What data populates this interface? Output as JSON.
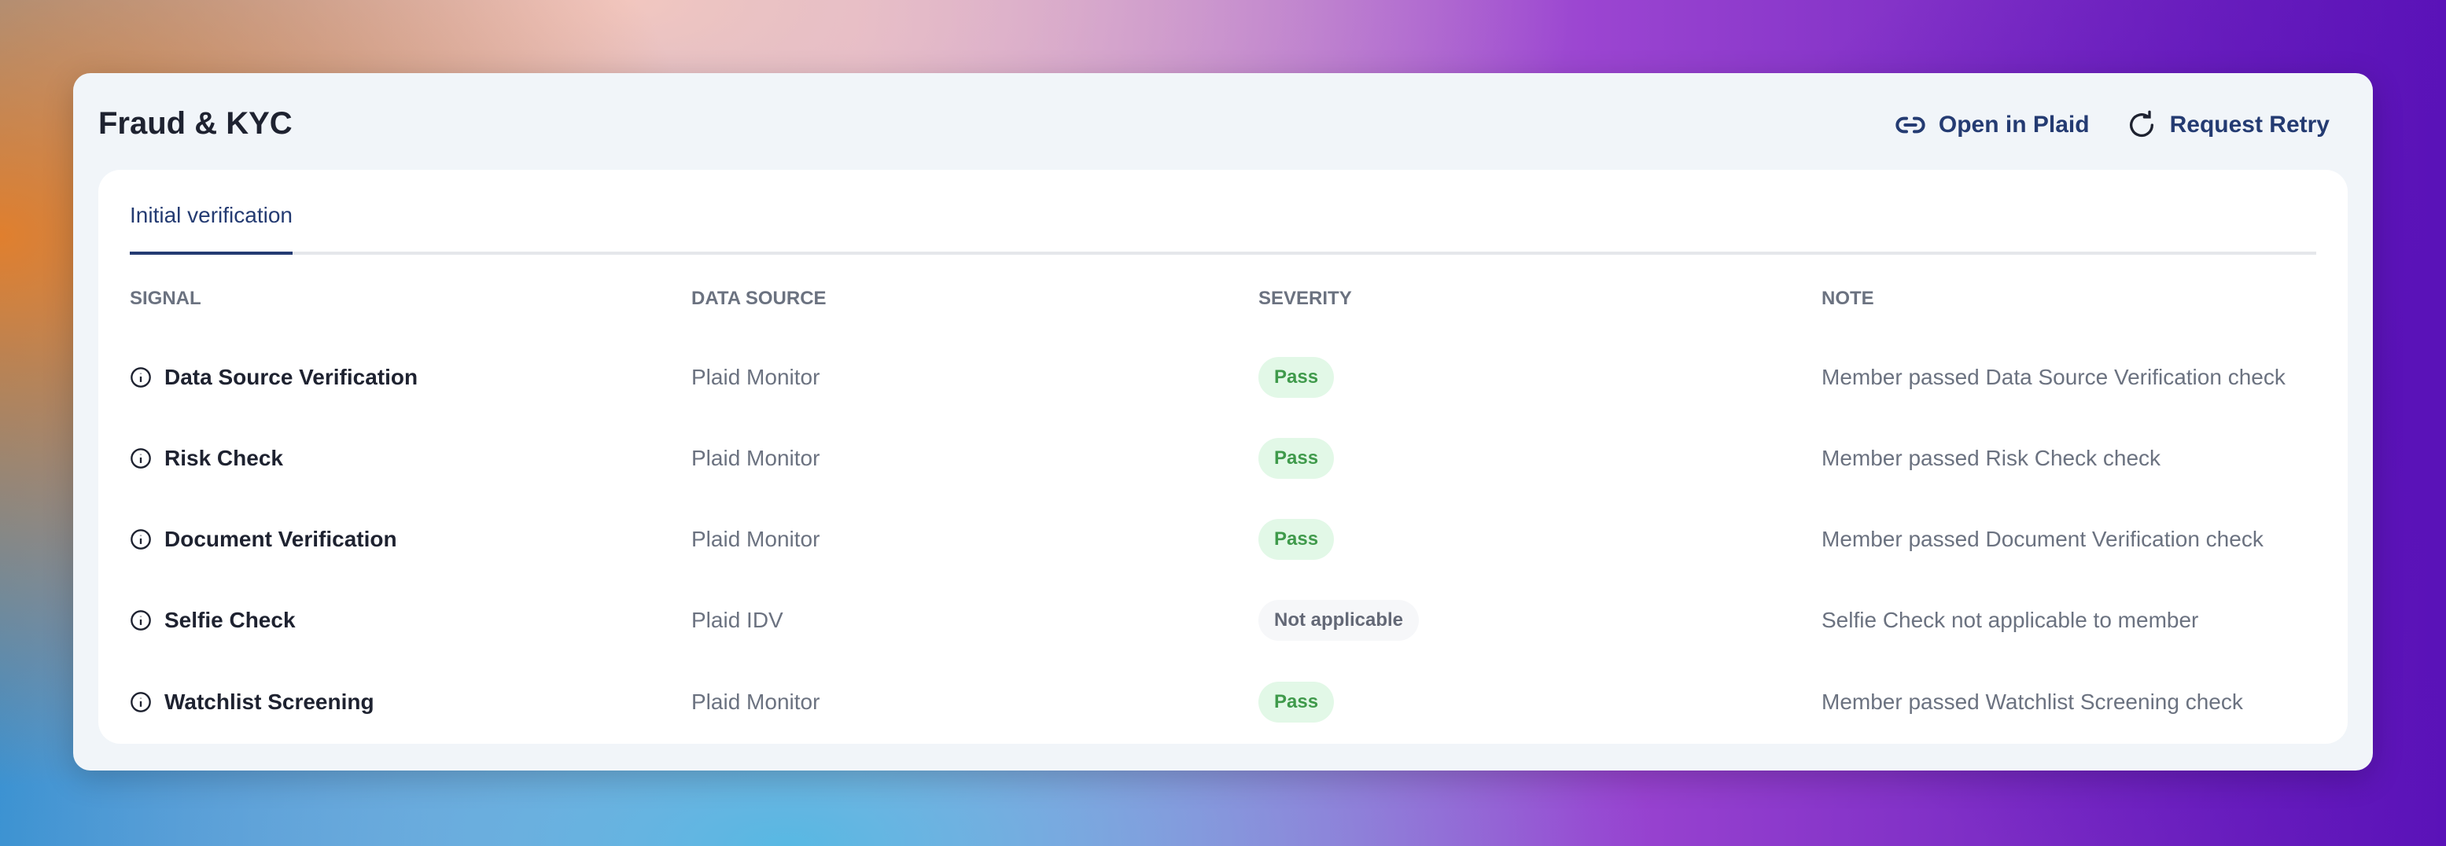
{
  "header": {
    "title": "Fraud & KYC",
    "actions": [
      {
        "label": "Open in Plaid",
        "icon": "link-icon"
      },
      {
        "label": "Request Retry",
        "icon": "refresh-icon"
      }
    ]
  },
  "tabs": [
    {
      "label": "Initial verification",
      "active": true
    }
  ],
  "table": {
    "columns": [
      "SIGNAL",
      "DATA SOURCE",
      "SEVERITY",
      "NOTE"
    ],
    "rows": [
      {
        "signal": "Data Source Verification",
        "source": "Plaid Monitor",
        "severity": "Pass",
        "note": "Member passed Data Source Verification check"
      },
      {
        "signal": "Risk Check",
        "source": "Plaid Monitor",
        "severity": "Pass",
        "note": "Member passed Risk Check check"
      },
      {
        "signal": "Document Verification",
        "source": "Plaid Monitor",
        "severity": "Pass",
        "note": "Member passed Document Verification check"
      },
      {
        "signal": "Selfie Check",
        "source": "Plaid IDV",
        "severity": "Not applicable",
        "note": "Selfie Check not applicable to member"
      },
      {
        "signal": "Watchlist Screening",
        "source": "Plaid Monitor",
        "severity": "Pass",
        "note": "Member passed Watchlist Screening check"
      }
    ]
  },
  "colors": {
    "accent": "#243b72",
    "pass_bg": "#e2f8e7",
    "pass_text": "#3f9a4b",
    "na_bg": "#f6f7f9"
  }
}
